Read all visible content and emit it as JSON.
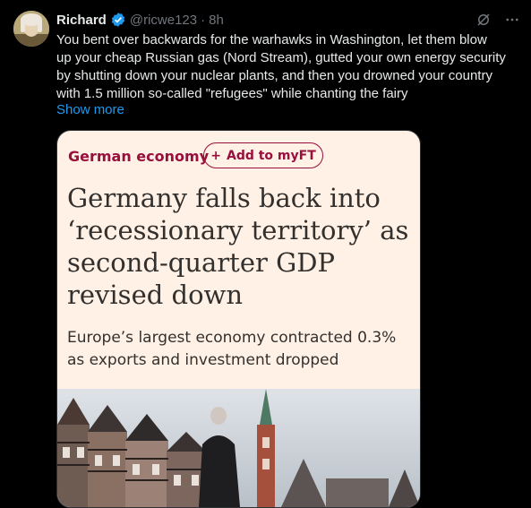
{
  "tweet": {
    "author_name": "Richard",
    "handle": "@ricwe123",
    "separator": "·",
    "time": "8h",
    "text": "You bent over backwards for the warhawks in Washington, let them blow\nup your cheap Russian gas (Nord Stream), gutted your own energy security\nby shutting down your nuclear plants, and then you drowned your country\nwith 1.5 million so-called \"refugees\" while chanting the fairy",
    "show_more": "Show more"
  },
  "icons": {
    "verified": "verified-badge-icon",
    "grok": "grok-icon",
    "more": "more-icon"
  },
  "card": {
    "section": "German economy",
    "add_label": "Add to myFT",
    "headline": "Germany falls back into ‘recessionary territory’ as second-quarter GDP revised down",
    "standfirst": "Europe’s largest economy contracted 0.3% as exports and investment dropped"
  },
  "colors": {
    "background": "#000000",
    "text": "#e7e9ea",
    "muted": "#71767b",
    "link": "#1d9bf0",
    "verified": "#1d9bf0",
    "ft_background": "#fff1e5",
    "ft_claret": "#990f3d",
    "ft_text": "#33302e"
  }
}
